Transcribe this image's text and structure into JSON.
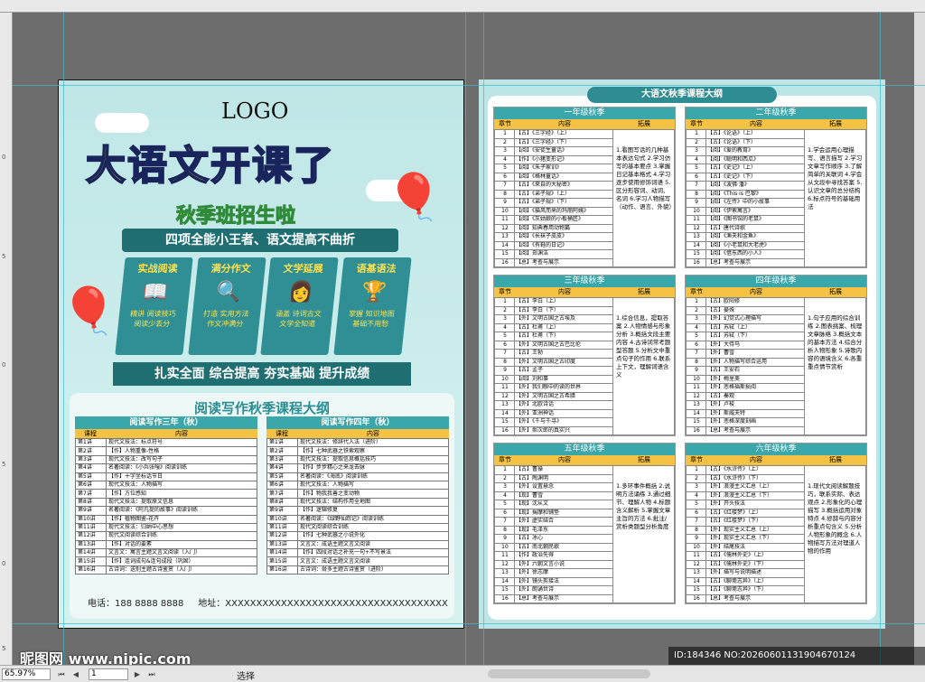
{
  "flyer_front": {
    "logo": "LOGO",
    "title_part1": "大语文",
    "title_part2": "开课了",
    "subtitle": "秋季班招生啦",
    "banner": "四项全能小王者、语文提高不曲折",
    "features": [
      {
        "title": "实战阅读",
        "icon": "book-icon",
        "desc1": "精讲 阅读技巧",
        "desc2": "阅读少丢分"
      },
      {
        "title": "满分作文",
        "icon": "magnifier-icon",
        "desc1": "打造 实用方法",
        "desc2": "作文冲满分"
      },
      {
        "title": "文学延展",
        "icon": "reader-icon",
        "desc1": "涵盖 诗词古文",
        "desc2": "文学全知道"
      },
      {
        "title": "语基语法",
        "icon": "trophy-icon",
        "desc1": "掌握 知识地图",
        "desc2": "基础不用愁"
      }
    ],
    "slogan": "扎实全面 综合提高 夯实基础 提升成绩",
    "outline_title": "阅读写作秋季课程大纲",
    "grade3": {
      "header": "阅读写作三年（秋）",
      "col_lesson": "课程",
      "col_content": "内容",
      "rows": [
        [
          "第1讲",
          "现代文技法：标点符号"
        ],
        [
          "第2讲",
          "【作】人物重像-性格"
        ],
        [
          "第3讲",
          "现代文技法：改写句子"
        ],
        [
          "第4讲",
          "名著阅读：《小兵张嘎》阅读训练"
        ],
        [
          "第5讲",
          "【作】十字坐标话节日"
        ],
        [
          "第6讲",
          "现代文技法：人物描写"
        ],
        [
          "第7讲",
          "【作】方位感知"
        ],
        [
          "第8讲",
          "现代文技法：提取原文信息"
        ],
        [
          "第9讲",
          "名著阅读：《阿凡提的故事》阅读训练"
        ],
        [
          "第10讲",
          "【作】植物图鉴-花卉"
        ],
        [
          "第11讲",
          "现代文技法：归纳中心思想"
        ],
        [
          "第12讲",
          "现代文阅读综合训练"
        ],
        [
          "第13讲",
          "【作】对话的要素"
        ],
        [
          "第14讲",
          "文言文：寓言主题文言文阅读（入门）"
        ],
        [
          "第15讲",
          "【作】连词成句&连句成段（巩固）"
        ],
        [
          "第16讲",
          "古诗词：送别主题古诗鉴赏（入门）"
        ]
      ]
    },
    "grade4": {
      "header": "阅读写作四年（秋）",
      "col_lesson": "课程",
      "col_content": "内容",
      "rows": [
        [
          "第1讲",
          "现代文技法：修辞代入法（进阶）"
        ],
        [
          "第2讲",
          "【作】七种武器之铁索观察"
        ],
        [
          "第3讲",
          "现代文技法：提取信息概括技巧"
        ],
        [
          "第4讲",
          "【作】步步精心之来龙去脉"
        ],
        [
          "第5讲",
          "名著阅读：《海底》阅读训练"
        ],
        [
          "第6讲",
          "现代文技法：人物描写"
        ],
        [
          "第7讲",
          "【作】物我我善之变动物"
        ],
        [
          "第8讲",
          "现代文技法：结构作用全地图"
        ],
        [
          "第9讲",
          "【作】逻辑修复"
        ],
        [
          "第10讲",
          "名著阅读：《绿野仙踪记》阅读训练"
        ],
        [
          "第11讲",
          "现代文阅读综合训练"
        ],
        [
          "第12讲",
          "【作】七种武器之小说外化"
        ],
        [
          "第13讲",
          "文言文：成语主题文言文阅读"
        ],
        [
          "第14讲",
          "【作】四段对话之补充一句+不写景法"
        ],
        [
          "第15讲",
          "文言文：成语主题文言文阅读"
        ],
        [
          "第16讲",
          "古诗词：骨多主题古诗鉴赏（进阶）"
        ]
      ]
    },
    "contact_phone": "电话：188 8888 8888",
    "contact_address": "地址：XXXXXXXXXXXXXXXXXXXXXXXXXXXXXXXXXXXX"
  },
  "flyer_back": {
    "title": "大语文秋季课程大纲",
    "col_section": "章节",
    "col_content": "内容",
    "col_ext": "拓展",
    "grades": [
      {
        "name": "一年级秋季",
        "rows": [
          [
            "1",
            "【古】《三字经》（上）"
          ],
          [
            "2",
            "【古】《三字经》（下）"
          ],
          [
            "3",
            "【阅】《安徒生童话》"
          ],
          [
            "4",
            "【作】《小猪变形记》"
          ],
          [
            "5",
            "【阅】《朱子家训》"
          ],
          [
            "6",
            "【阅】《格林童话》"
          ],
          [
            "7",
            "【古】《來自的大秘密》"
          ],
          [
            "8",
            "【古】《弟子规》（上）"
          ],
          [
            "9",
            "【古】《弟子规》（下）"
          ],
          [
            "10",
            "【阅】《猫风而来的玛丽阿姨》"
          ],
          [
            "11",
            "【阅】《灰姑娘的小板桶匠》"
          ],
          [
            "12",
            "【阅】知典春用动物篇"
          ],
          [
            "13",
            "【阅】《长袜子皮皮》"
          ],
          [
            "14",
            "【阅】《有鞋的日记》"
          ],
          [
            "15",
            "【阅】郑渊洁"
          ],
          [
            "16",
            "【总】考查与展示"
          ]
        ],
        "ext": "1.看图写话的几种基本表达句式 2.学习仿写的基本要点 3.掌握日记基本格式 4.学习逐步使用修饰词语 5.区分形容词、动词、名词 6.学习人物描写（动作、语言、外貌）"
      },
      {
        "name": "二年级秋季",
        "rows": [
          [
            "1",
            "【古】《论语》（上）"
          ],
          [
            "2",
            "【古】《论语》（下）"
          ],
          [
            "3",
            "【阅】《爱的教育》"
          ],
          [
            "4",
            "【阅】《聪明和西瓜》"
          ],
          [
            "5",
            "【古】《史记》（上）"
          ],
          [
            "6",
            "【古】《史记》（下）"
          ],
          [
            "7",
            "【阅】《波佛·潘》"
          ],
          [
            "8",
            "【阅】《This is 巴黎》"
          ],
          [
            "9",
            "【阅】《左传》中的小故事"
          ],
          [
            "10",
            "【阅】《伊索寓言》"
          ],
          [
            "11",
            "【阅】《图书馆的老鼠》"
          ],
          [
            "12",
            "【古】唐代诗歌"
          ],
          [
            "13",
            "【阅】《渔夫和金鱼》"
          ],
          [
            "14",
            "【阅】《小老鼠和大老虎》"
          ],
          [
            "15",
            "【阅】《借东西的小人》"
          ],
          [
            "16",
            "【总】考查与展示"
          ]
        ],
        "ext": "1.学会运用心理描写、语言描写 2.学习文章写作顺序 3.了解简单的关联词 4.学会从文段中寻找答案 5.认识文章的总分结构 6.标点符号的基础用法"
      },
      {
        "name": "三年级秋季",
        "rows": [
          [
            "1",
            "【古】李白（上）"
          ],
          [
            "2",
            "【古】李白（下）"
          ],
          [
            "3",
            "【外】文明古国之古埃及"
          ],
          [
            "4",
            "【古】杜甫（上）"
          ],
          [
            "5",
            "【古】杜甫（下）"
          ],
          [
            "6",
            "【外】文明古国之古巴比伦"
          ],
          [
            "7",
            "【古】王勃"
          ],
          [
            "8",
            "【外】文明古国之古印度"
          ],
          [
            "9",
            "【古】孟子"
          ],
          [
            "10",
            "【阅】刘和事"
          ],
          [
            "11",
            "【外】我们眼中的读的世界"
          ],
          [
            "12",
            "【外】文明古国之古希腊"
          ],
          [
            "13",
            "【外】北欧诗话"
          ],
          [
            "14",
            "【外】亚洲神话"
          ],
          [
            "15",
            "【外】《千与千寻》"
          ],
          [
            "16",
            "【外】郝次郎的真实兴"
          ]
        ],
        "ext": "1.综合信息，提取答案 2.人物情感与形象分析 3.概括文段主要内容 4.古诗词常考题型答题 5.分析文中重点句子的作用 6.联系上下文，理解词语含义"
      },
      {
        "name": "四年级秋季",
        "rows": [
          [
            "1",
            "【古】欧阳修"
          ],
          [
            "2",
            "【古】晏殊"
          ],
          [
            "3",
            "【外】幻觉式心理描写"
          ],
          [
            "4",
            "【古】苏轼（上）"
          ],
          [
            "5",
            "【古】苏轼（下）"
          ],
          [
            "6",
            "【外】大侍马"
          ],
          [
            "7",
            "【外】曹雪"
          ],
          [
            "8",
            "【外】人物描写综合运用"
          ],
          [
            "9",
            "【古】王安石"
          ],
          [
            "10",
            "【外】梅里美"
          ],
          [
            "11",
            "【外】悲格福斯损阅"
          ],
          [
            "12",
            "【古】秦观"
          ],
          [
            "13",
            "【外】卢梭"
          ],
          [
            "14",
            "【外】斯威夫特"
          ],
          [
            "15",
            "【外】悲格深度刻画"
          ],
          [
            "16",
            "【总】考查与展示"
          ]
        ],
        "ext": "1.句子应用的综合训练 2.图表挑案、梳理文章脉络 3.概括文本的基本方法 4.综合分析人物形象 5.诗歌内容的语境含义 6.各重重点情节赏析"
      },
      {
        "name": "五年级秋季",
        "rows": [
          [
            "1",
            "【古】曹操"
          ],
          [
            "2",
            "【古】陶渊明"
          ],
          [
            "3",
            "【外】设置悬念"
          ],
          [
            "4",
            "【现】曹雪"
          ],
          [
            "5",
            "【现】沈从文"
          ],
          [
            "6",
            "【现】揣摩和铺垫"
          ],
          [
            "7",
            "【外】虚实结合"
          ],
          [
            "8",
            "【现】毛泽东"
          ],
          [
            "9",
            "【古】冰心"
          ],
          [
            "10",
            "【古】南北朝民歌"
          ],
          [
            "11",
            "【作】政治先得"
          ],
          [
            "12",
            "【外】六朝文言小说"
          ],
          [
            "13",
            "【外】徐志摩"
          ],
          [
            "14",
            "【外】镜头剪接法"
          ],
          [
            "15",
            "【外】朗诵世诗"
          ],
          [
            "16",
            "【总】考查与展示"
          ]
        ],
        "ext": "1.多环事件概括 2.说明方法诵练 3.通过细节、理解人物 4.标题含义解析 5.掌握文章主旨的方法 6.批注/赏析类题型分析角度"
      },
      {
        "name": "六年级秋季",
        "rows": [
          [
            "1",
            "【古】《水浒传》（上）"
          ],
          [
            "2",
            "【古】《水浒传》（下）"
          ],
          [
            "3",
            "【外】浪漫主义汇总（上）"
          ],
          [
            "4",
            "【外】浪漫主义汇总（下）"
          ],
          [
            "5",
            "【外】开头技法"
          ],
          [
            "6",
            "【古】《红楼梦》（上）"
          ],
          [
            "7",
            "【古】《红楼梦》（下）"
          ],
          [
            "8",
            "【外】现实主义汇总（上）"
          ],
          [
            "9",
            "【外】现实主义汇总（下）"
          ],
          [
            "10",
            "【外】结尾技法"
          ],
          [
            "11",
            "【古】《儒林外史》（上）"
          ],
          [
            "12",
            "【古】《儒林外史》（下）"
          ],
          [
            "13",
            "【外】描写与说明描述"
          ],
          [
            "14",
            "【古】《聊斋志异》（上）"
          ],
          [
            "15",
            "【古】《聊斋志异》（下）"
          ],
          [
            "16",
            "【总】考查与展示"
          ]
        ],
        "ext": "1.现代文阅读解题技巧，联系实际、表达观点 2.形象化的心理描写 3.概括运用对象特点 4.修辞与内容分析重点句含义 5.分析人物形象的概念 6.人物描写方法对理道人物的作用"
      }
    ]
  },
  "app": {
    "zoom": "65.97%",
    "page": "1",
    "status": "选择",
    "ruler_marks": [
      "0",
      "5",
      "0",
      "5",
      "0",
      "5"
    ]
  },
  "watermark": {
    "left": "昵图网 www.nipic.com",
    "right": "ID:184346 NO:20260601131904670124"
  },
  "colors": {
    "teal": "#3aa7ab",
    "dark_teal": "#1f6e72",
    "yellow": "#f6c244",
    "title_yellow": "#ffd51f",
    "navy": "#19245c"
  }
}
